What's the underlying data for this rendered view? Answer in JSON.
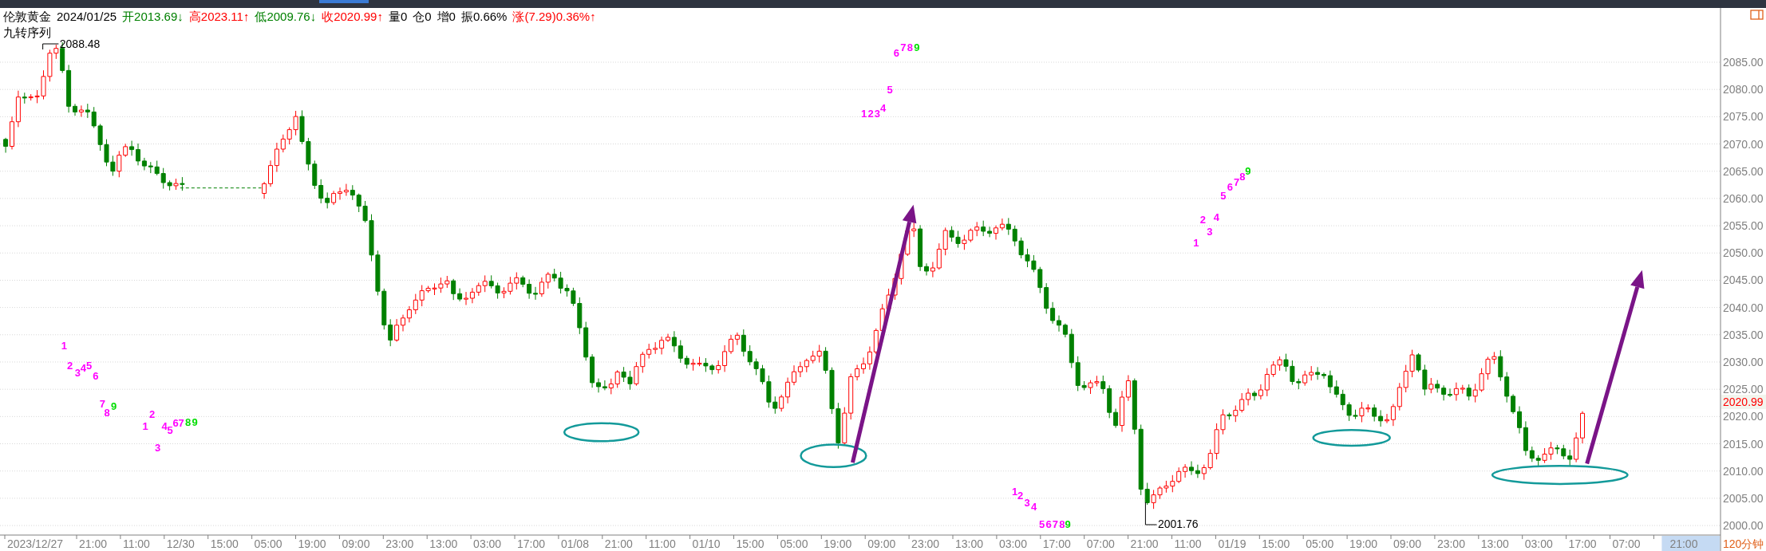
{
  "header": {
    "items": [
      {
        "text": "伦敦黄金"
      },
      {
        "text": "2024/01/25"
      },
      {
        "text": "开2013.69↓",
        "color": "#008000"
      },
      {
        "text": "高2023.11↑",
        "color": "#ff0000"
      },
      {
        "text": "低2009.76↓",
        "color": "#008000"
      },
      {
        "text": "收2020.99↑",
        "color": "#ff0000"
      },
      {
        "text": "量0"
      },
      {
        "text": "仓0"
      },
      {
        "text": "增0"
      },
      {
        "text": "振0.66%"
      },
      {
        "text": "涨(7.29)0.36%↑",
        "color": "#ff0000"
      }
    ],
    "indicator": "九转序列"
  },
  "chart": {
    "high_label": "2088.48",
    "low_label": "2001.76",
    "sequences": [
      {
        "digits": [
          {
            "text": "1",
            "color": "#ff00ff"
          },
          {
            "text": "2",
            "color": "#ff00ff"
          },
          {
            "text": "3",
            "color": "#ff00ff"
          },
          {
            "text": "4",
            "color": "#ff00ff"
          },
          {
            "text": "5",
            "color": "#ff00ff"
          },
          {
            "text": "6",
            "color": "#ff00ff"
          },
          {
            "text": "7",
            "color": "#ff00ff"
          },
          {
            "text": "8",
            "color": "#ff00ff"
          },
          {
            "text": "9",
            "color": "#00dd00"
          }
        ]
      },
      {
        "digits": [
          {
            "text": "1",
            "color": "#ff00ff"
          },
          {
            "text": "2",
            "color": "#ff00ff"
          },
          {
            "text": "3",
            "color": "#ff00ff"
          },
          {
            "text": "4",
            "color": "#ff00ff"
          },
          {
            "text": "5",
            "color": "#ff00ff"
          },
          {
            "text": "6",
            "color": "#ff00ff"
          },
          {
            "text": "7",
            "color": "#ff00ff"
          },
          {
            "text": "8",
            "color": "#00dd00"
          },
          {
            "text": "9",
            "color": "#00dd00"
          }
        ]
      },
      {
        "digits": [
          {
            "text": "1",
            "color": "#ff00ff"
          },
          {
            "text": "2",
            "color": "#ff00ff"
          },
          {
            "text": "3",
            "color": "#ff00ff"
          },
          {
            "text": "4",
            "color": "#ff00ff"
          },
          {
            "text": "5",
            "color": "#ff00ff"
          },
          {
            "text": "6",
            "color": "#ff00ff"
          },
          {
            "text": "7",
            "color": "#ff00ff"
          },
          {
            "text": "8",
            "color": "#ff00ff"
          },
          {
            "text": "9",
            "color": "#00dd00"
          }
        ]
      },
      {
        "digits": [
          {
            "text": "1",
            "color": "#ff00ff"
          },
          {
            "text": "2",
            "color": "#ff00ff"
          },
          {
            "text": "3",
            "color": "#ff00ff"
          },
          {
            "text": "4",
            "color": "#ff00ff"
          },
          {
            "text": "5",
            "color": "#ff00ff"
          },
          {
            "text": "6",
            "color": "#ff00ff"
          },
          {
            "text": "7",
            "color": "#ff00ff"
          },
          {
            "text": "8",
            "color": "#ff00ff"
          },
          {
            "text": "9",
            "color": "#00dd00"
          }
        ]
      },
      {
        "digits": [
          {
            "text": "1",
            "color": "#ff00ff"
          },
          {
            "text": "2",
            "color": "#ff00ff"
          },
          {
            "text": "3",
            "color": "#ff00ff"
          },
          {
            "text": "4",
            "color": "#ff00ff"
          },
          {
            "text": "5",
            "color": "#ff00ff"
          },
          {
            "text": "6",
            "color": "#ff00ff"
          },
          {
            "text": "7",
            "color": "#ff00ff"
          },
          {
            "text": "8",
            "color": "#ff00ff"
          },
          {
            "text": "9",
            "color": "#00dd00"
          }
        ]
      }
    ]
  },
  "price_axis": {
    "labels": [
      "2085.00",
      "2080.00",
      "2075.00",
      "2070.00",
      "2065.00",
      "2060.00",
      "2055.00",
      "2050.00",
      "2045.00",
      "2040.00",
      "2035.00",
      "2030.00",
      "2025.00",
      "2020.00",
      "2015.00",
      "2010.00",
      "2005.00",
      "2000.00"
    ],
    "current_price": "2020.99"
  },
  "time_axis": {
    "labels": [
      {
        "text": "2023/12/27",
        "highlighted": false
      },
      {
        "text": "21:00",
        "highlighted": false
      },
      {
        "text": "11:00",
        "highlighted": false
      },
      {
        "text": "12/30",
        "highlighted": false
      },
      {
        "text": "15:00",
        "highlighted": false
      },
      {
        "text": "05:00",
        "highlighted": false
      },
      {
        "text": "19:00",
        "highlighted": false
      },
      {
        "text": "09:00",
        "highlighted": false
      },
      {
        "text": "23:00",
        "highlighted": false
      },
      {
        "text": "13:00",
        "highlighted": false
      },
      {
        "text": "03:00",
        "highlighted": false
      },
      {
        "text": "17:00",
        "highlighted": false
      },
      {
        "text": "01/08",
        "highlighted": false
      },
      {
        "text": "21:00",
        "highlighted": false
      },
      {
        "text": "11:00",
        "highlighted": false
      },
      {
        "text": "01/10",
        "highlighted": false
      },
      {
        "text": "15:00",
        "highlighted": false
      },
      {
        "text": "05:00",
        "highlighted": false
      },
      {
        "text": "19:00",
        "highlighted": false
      },
      {
        "text": "09:00",
        "highlighted": false
      },
      {
        "text": "23:00",
        "highlighted": false
      },
      {
        "text": "13:00",
        "highlighted": false
      },
      {
        "text": "03:00",
        "highlighted": false
      },
      {
        "text": "17:00",
        "highlighted": false
      },
      {
        "text": "07:00",
        "highlighted": false
      },
      {
        "text": "21:00",
        "highlighted": false
      },
      {
        "text": "11:00",
        "highlighted": false
      },
      {
        "text": "01/19",
        "highlighted": false
      },
      {
        "text": "15:00",
        "highlighted": false
      },
      {
        "text": "05:00",
        "highlighted": false
      },
      {
        "text": "19:00",
        "highlighted": false
      },
      {
        "text": "09:00",
        "highlighted": false
      },
      {
        "text": "23:00",
        "highlighted": false
      },
      {
        "text": "13:00",
        "highlighted": false
      },
      {
        "text": "03:00",
        "highlighted": false
      },
      {
        "text": "17:00",
        "highlighted": false
      },
      {
        "text": "07:00",
        "highlighted": false
      },
      {
        "text": "21:00",
        "highlighted": true
      }
    ],
    "period": "120分钟"
  }
}
